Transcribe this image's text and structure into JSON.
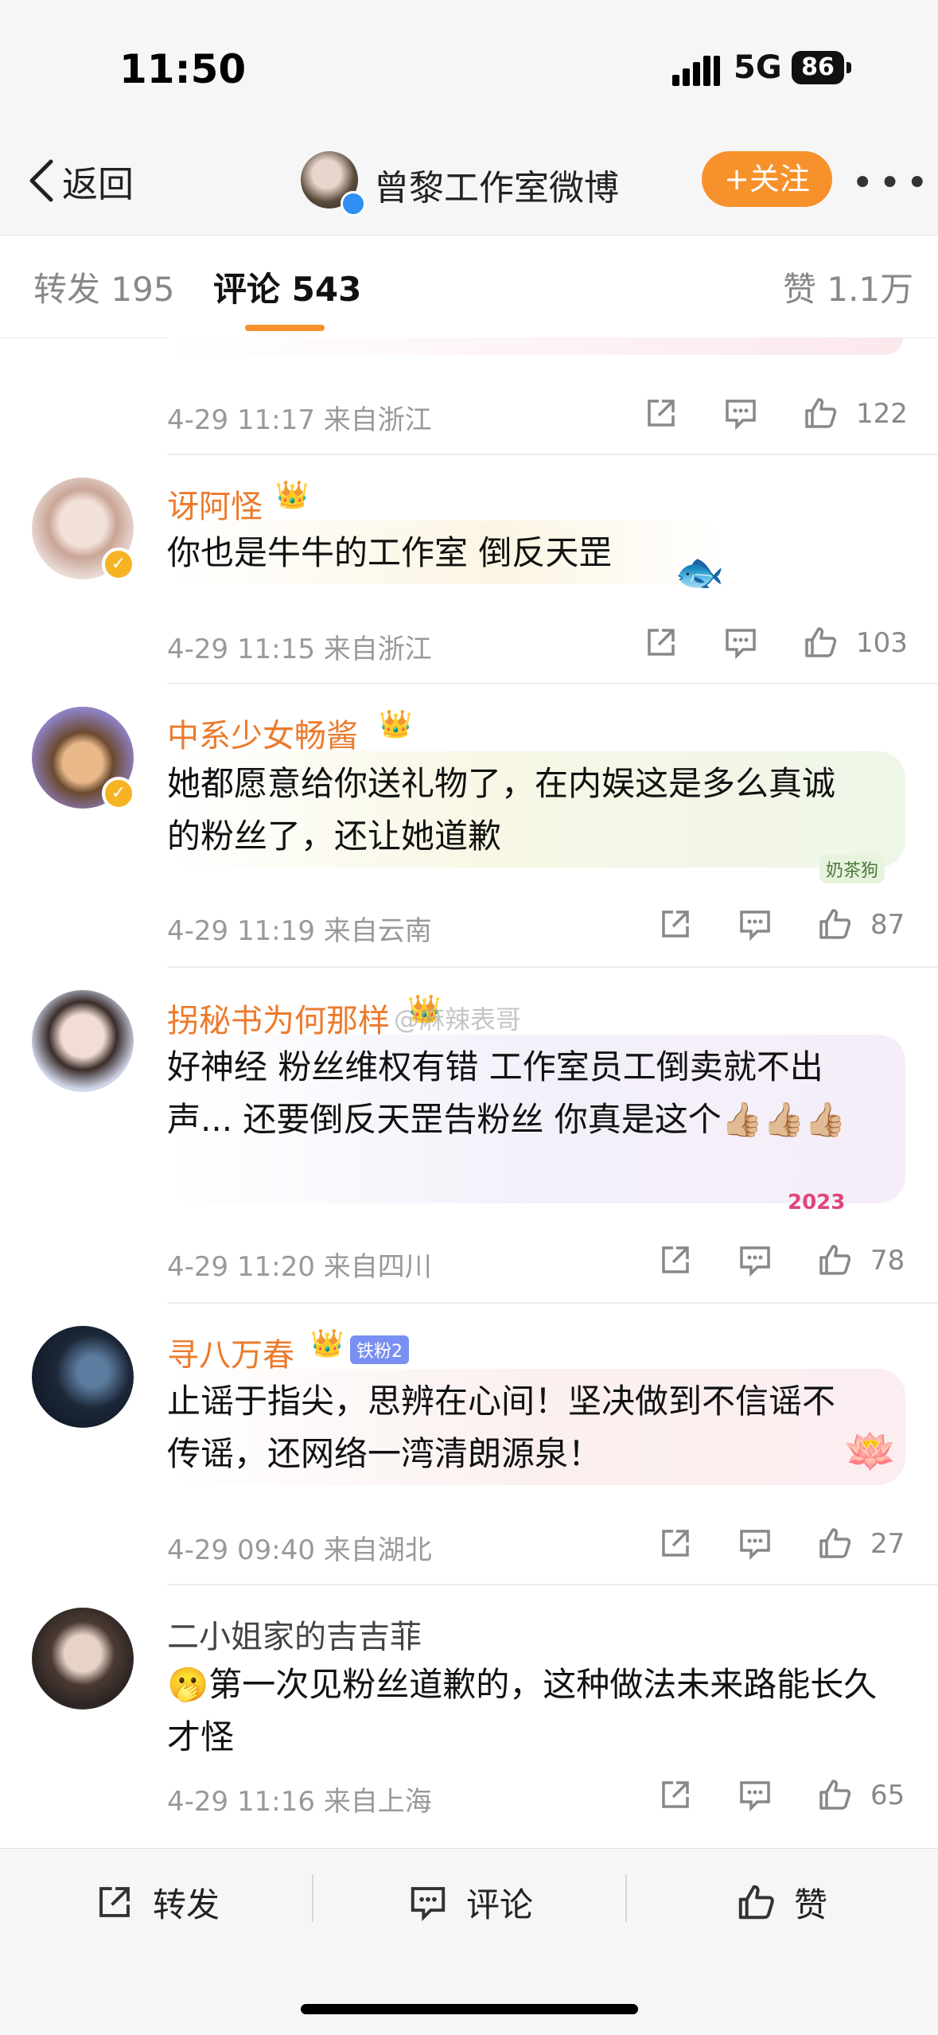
{
  "status_bar": {
    "time": "11:50",
    "network": "5G",
    "battery": "86"
  },
  "nav": {
    "back_label": "返回",
    "title": "曾黎工作室微博",
    "follow_label": "+关注"
  },
  "tabs": [
    {
      "label": "转发 195"
    },
    {
      "label": "评论 543"
    },
    {
      "label": "赞 1.1万"
    }
  ],
  "watermark": "@麻辣表哥",
  "comments": [
    {
      "meta": "4-29 11:17 来自浙江",
      "likes": "122"
    },
    {
      "username": "讶阿怪",
      "content": "你也是牛牛的工作室 倒反天罡",
      "meta": "4-29 11:15 来自浙江",
      "likes": "103"
    },
    {
      "username": "中系少女畅酱",
      "content": "她都愿意给你送礼物了，在内娱这是多么真诚的粉丝了，还让她道歉",
      "meta": "4-29 11:19 来自云南",
      "likes": "87"
    },
    {
      "username": "拐秘书为何那样",
      "content": "好神经 粉丝维权有错 工作室员工倒卖就不出声... 还要倒反天罡告粉丝 你真是这个👍🏼👍🏼👍🏼",
      "meta": "4-29 11:20 来自四川",
      "likes": "78"
    },
    {
      "username": "寻八万春",
      "fan_badge": "铁粉2",
      "content": "止谣于指尖，思辨在心间！坚决做到不信谣不传谣，还网络一湾清朗源泉！",
      "meta": "4-29 09:40 来自湖北",
      "likes": "27"
    },
    {
      "username": "二小姐家的吉吉菲",
      "content": "🫢第一次见粉丝道歉的，这种做法未来路能长久才怪",
      "meta": "4-29 11:16 来自上海",
      "likes": "65"
    }
  ],
  "bubble_stickers": {
    "c2": "奶茶狗",
    "c3": "2023"
  },
  "bottom_bar": {
    "repost": "转发",
    "comment": "评论",
    "like": "赞"
  },
  "colors": {
    "accent": "#f7912b",
    "username": "#ec7a2c",
    "meta": "#999999"
  }
}
